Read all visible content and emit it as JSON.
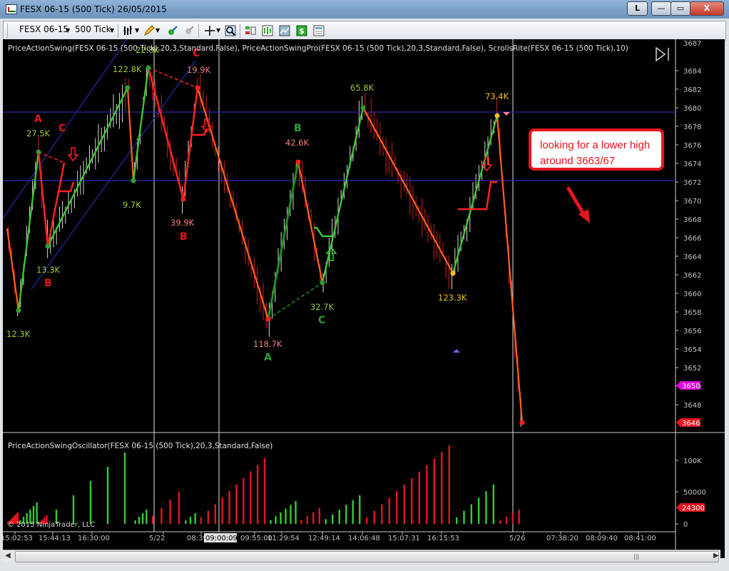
{
  "window": {
    "title": "FESX 06-15 (500 Tick)  26/05/2015",
    "buttons": {
      "link": "L",
      "minimize": "—",
      "maximize": "▭",
      "close": "X"
    }
  },
  "toolbar": {
    "instrument": "FESX 06-15",
    "interval": "500 Tick"
  },
  "indicators": {
    "main_label": "PriceActionSwing(FESX 06-15 (500 Tick),20,3,Standard,False), PriceActionSwingPro(FESX 06-15 (500 Tick),20,3,Standard,False), ScrollsRite(FESX 06-15 (500 Tick),10)",
    "osc_label": "PriceActionSwingOscillator(FESX 06-15 (500 Tick),20,3,Standard,False)"
  },
  "price_axis": {
    "top_price": "3687",
    "ticks": [
      "3684",
      "3682",
      "3680",
      "3678",
      "3676",
      "3674",
      "3672",
      "3670",
      "3668",
      "3666",
      "3664",
      "3662",
      "3660",
      "3658",
      "3656",
      "3654",
      "3652",
      "3650",
      "3648"
    ],
    "markers": [
      {
        "label": "3650",
        "color": "#e000e0"
      },
      {
        "label": "3646",
        "color": "#e8141f"
      }
    ]
  },
  "osc_axis": {
    "ticks": [
      "100K",
      "50000",
      "0"
    ],
    "marker": "24300"
  },
  "time_axis": {
    "ticks": [
      "15:02:53",
      "15:44:13",
      "16:30:00",
      "5/22",
      "08:39:00:09",
      "09:55:00",
      "11:29:54",
      "12:49:14",
      "14:06:48",
      "15:07:31",
      "16:15:53",
      "5/26",
      "07:38:20",
      "08:09:40",
      "08:41:00"
    ],
    "crosshair_time": "09:00:09"
  },
  "swing_labels": [
    {
      "text": "12.3K",
      "color": "#9ccc3c"
    },
    {
      "text": "27.5K",
      "color": "#9ccc3c"
    },
    {
      "text": "A",
      "color": "#e8141f"
    },
    {
      "text": "C",
      "color": "#e8141f"
    },
    {
      "text": "13.3K",
      "color": "#9ccc3c"
    },
    {
      "text": "B",
      "color": "#e8141f"
    },
    {
      "text": "122.8K",
      "color": "#9ccc3c"
    },
    {
      "text": "22.8K",
      "color": "#9ccc3c"
    },
    {
      "text": "C",
      "color": "#e8141f"
    },
    {
      "text": "19.9K",
      "color": "#f08080"
    },
    {
      "text": "9.7K",
      "color": "#9ccc3c"
    },
    {
      "text": "39.9K",
      "color": "#f08080"
    },
    {
      "text": "B",
      "color": "#e8141f"
    },
    {
      "text": "B",
      "color": "#2ea02e"
    },
    {
      "text": "42.6K",
      "color": "#f08080"
    },
    {
      "text": "118.7K",
      "color": "#f08080"
    },
    {
      "text": "A",
      "color": "#2ea02e"
    },
    {
      "text": "32.7K",
      "color": "#9ccc3c"
    },
    {
      "text": "C",
      "color": "#2ea02e"
    },
    {
      "text": "65.8K",
      "color": "#9ccc3c"
    },
    {
      "text": "123.3K",
      "color": "#f0c020"
    },
    {
      "text": "73.4K",
      "color": "#f0c020"
    }
  ],
  "annotation": {
    "text": "looking for a lower high around 3663/67"
  },
  "copyright": "© 2015 NinjaTrader, LLC",
  "colors": {
    "up_swing": "#33cc33",
    "down_swing": "#ff6020",
    "box": "#e8141f",
    "hline": "#2a2aa8"
  }
}
